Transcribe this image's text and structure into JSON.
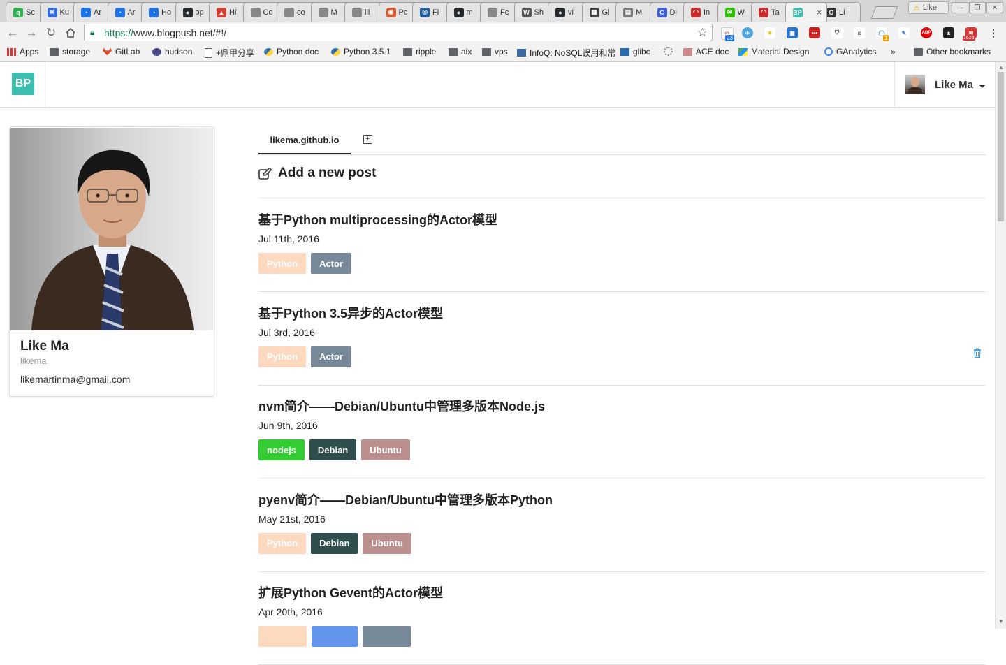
{
  "browser": {
    "tabs": [
      {
        "title": "Sc",
        "fav_color": "#2bb24c",
        "fav_text": "q"
      },
      {
        "title": "Ku",
        "fav_color": "#326ce5",
        "fav_text": "⎈"
      },
      {
        "title": "Ar",
        "fav_color": "#1a73e8",
        "fav_text": "◔"
      },
      {
        "title": "Ar",
        "fav_color": "#1a73e8",
        "fav_text": "◔"
      },
      {
        "title": "Ho",
        "fav_color": "#1a73e8",
        "fav_text": "◔"
      },
      {
        "title": "op",
        "fav_color": "#24292e",
        "fav_text": "●"
      },
      {
        "title": "Hi",
        "fav_color": "#d23f31",
        "fav_text": "▲"
      },
      {
        "title": "Co",
        "fav_color": "#888888",
        "fav_text": ""
      },
      {
        "title": "co",
        "fav_color": "#888888",
        "fav_text": ""
      },
      {
        "title": "M",
        "fav_color": "#888888",
        "fav_text": ""
      },
      {
        "title": "lil",
        "fav_color": "#888888",
        "fav_text": ""
      },
      {
        "title": "Pc",
        "fav_color": "#e0582a",
        "fav_text": "◉"
      },
      {
        "title": "Fl",
        "fav_color": "#1e5aa0",
        "fav_text": "◎"
      },
      {
        "title": "m",
        "fav_color": "#24292e",
        "fav_text": "●"
      },
      {
        "title": "Fc",
        "fav_color": "#888888",
        "fav_text": ""
      },
      {
        "title": "Sh",
        "fav_color": "#555555",
        "fav_text": "W"
      },
      {
        "title": "vi",
        "fav_color": "#24292e",
        "fav_text": "●"
      },
      {
        "title": "Gi",
        "fav_color": "#444444",
        "fav_text": "▦"
      },
      {
        "title": "M",
        "fav_color": "#777777",
        "fav_text": "▤"
      },
      {
        "title": "Di",
        "fav_color": "#3b5bdb",
        "fav_text": "C"
      },
      {
        "title": "In",
        "fav_color": "#cc2b2b",
        "fav_text": "◠"
      },
      {
        "title": "W",
        "fav_color": "#2dc100",
        "fav_text": "✉"
      },
      {
        "title": "Ta",
        "fav_color": "#cc2b2b",
        "fav_text": "◠"
      },
      {
        "title": "",
        "fav_color": "#3cbfae",
        "fav_text": "BP"
      },
      {
        "title": "Li",
        "fav_color": "#333333",
        "fav_text": "O"
      }
    ],
    "profile_badge": "Like",
    "window_controls": {
      "minimize": "—",
      "maximize": "❐",
      "close": "✕"
    },
    "address": {
      "scheme": "https://",
      "rest": "www.blogpush.net/#!/"
    },
    "extension_badges": {
      "ext1": "23",
      "ext2": "1",
      "ext3": "1629"
    },
    "bookmarks": [
      {
        "label": "Apps",
        "type": "apps"
      },
      {
        "label": "storage",
        "type": "folder"
      },
      {
        "label": "GitLab",
        "type": "gitlab"
      },
      {
        "label": "hudson",
        "type": "hudson"
      },
      {
        "label": "+鼎甲分享",
        "type": "page"
      },
      {
        "label": "Python doc",
        "type": "python"
      },
      {
        "label": "Python 3.5.1",
        "type": "python"
      },
      {
        "label": "ripple",
        "type": "folder"
      },
      {
        "label": "aix",
        "type": "folder"
      },
      {
        "label": "vps",
        "type": "folder"
      },
      {
        "label": "InfoQ: NoSQL误用和常",
        "type": "infoq"
      },
      {
        "label": "glibc",
        "type": "glibc"
      },
      {
        "label": "",
        "type": "gear"
      },
      {
        "label": "ACE doc",
        "type": "ace"
      },
      {
        "label": "Material Design",
        "type": "material"
      },
      {
        "label": "GAnalytics",
        "type": "google"
      }
    ],
    "bookmarks_more": "»",
    "other_bookmarks": "Other bookmarks"
  },
  "app": {
    "brand": "BP",
    "user": {
      "name": "Like Ma"
    }
  },
  "profile": {
    "name": "Like Ma",
    "handle": "likema",
    "email": "likemartinma@gmail.com"
  },
  "blog_tab": "likema.github.io",
  "add_post_label": "Add a new post",
  "colors": {
    "accent": "#3cbfae",
    "tag_python_bg": "#fdd9bf",
    "tag_python_fg": "#ffffff",
    "tag_actor": "#778899",
    "tag_nodejs": "#33cc33",
    "tag_debian": "#2f4f4f",
    "tag_ubuntu": "#bc8f8f",
    "tag_gevent": "#6495ed"
  },
  "posts": [
    {
      "title": "基于Python multiprocessing的Actor模型",
      "date": "Jul 11th, 2016",
      "tags": [
        {
          "label": "Python",
          "kind": "python"
        },
        {
          "label": "Actor",
          "kind": "actor"
        }
      ]
    },
    {
      "title": "基于Python 3.5异步的Actor模型",
      "date": "Jul 3rd, 2016",
      "tags": [
        {
          "label": "Python",
          "kind": "python"
        },
        {
          "label": "Actor",
          "kind": "actor"
        }
      ],
      "has_delete": true
    },
    {
      "title": "nvm简介——Debian/Ubuntu中管理多版本Node.js",
      "date": "Jun 9th, 2016",
      "tags": [
        {
          "label": "nodejs",
          "kind": "nodejs"
        },
        {
          "label": "Debian",
          "kind": "debian"
        },
        {
          "label": "Ubuntu",
          "kind": "ubuntu"
        }
      ]
    },
    {
      "title": "pyenv简介——Debian/Ubuntu中管理多版本Python",
      "date": "May 21st, 2016",
      "tags": [
        {
          "label": "Python",
          "kind": "python"
        },
        {
          "label": "Debian",
          "kind": "debian"
        },
        {
          "label": "Ubuntu",
          "kind": "ubuntu"
        }
      ]
    },
    {
      "title": "扩展Python Gevent的Actor模型",
      "date": "Apr 20th, 2016",
      "tags": [
        {
          "label": "",
          "kind": "python"
        },
        {
          "label": "",
          "kind": "gevent"
        },
        {
          "label": "",
          "kind": "actor"
        }
      ]
    }
  ]
}
